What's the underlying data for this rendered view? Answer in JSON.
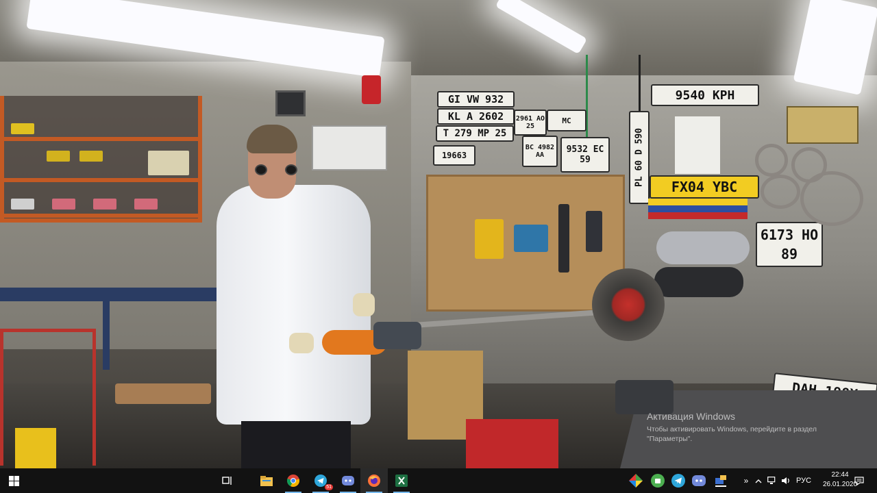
{
  "scene": {
    "plates": {
      "p1": "GI VW 932",
      "p2": "KL A 2602",
      "p3": "T 279 MP 25",
      "p4": "2961 AO 25",
      "p5": "19663",
      "p6": "BC 4982 AA",
      "p7": "9532 EC 59",
      "p8": "9540 KPH",
      "p9": "PL 60 D 590",
      "p10": "FX04 YBC",
      "p11": "6173 HO 89",
      "p12": "DAH.198X",
      "p13": "MC"
    }
  },
  "watermark": {
    "title": "Активация Windows",
    "line1": "Чтобы активировать Windows, перейдите в раздел",
    "line2": "\"Параметры\"."
  },
  "taskbar": {
    "apps": [
      {
        "name": "start-icon"
      },
      {
        "name": "task-view-icon"
      },
      {
        "name": "file-explorer-icon"
      },
      {
        "name": "chrome-icon"
      },
      {
        "name": "telegram-icon",
        "badge": "51"
      },
      {
        "name": "discord-icon"
      },
      {
        "name": "firefox-icon"
      },
      {
        "name": "excel-icon"
      }
    ],
    "tray": {
      "language": "РУС",
      "time": "22:44",
      "date": "26.01.2020"
    }
  }
}
